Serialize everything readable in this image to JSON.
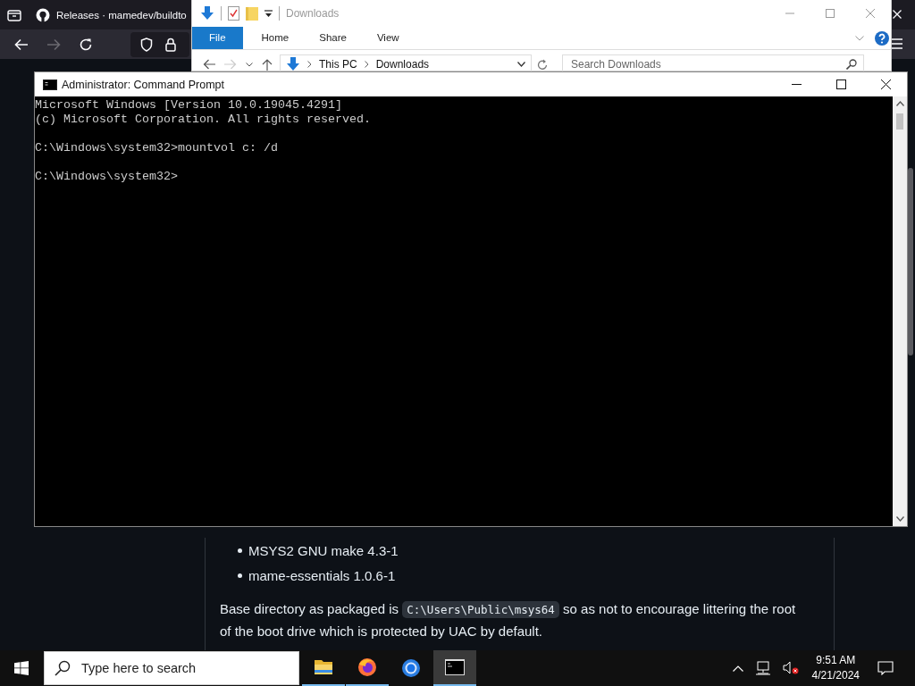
{
  "browser": {
    "tab_title": "Releases · mamedev/buildto",
    "page": {
      "list_items": [
        "MSYS2 GNU make 4.3-1",
        "mame-essentials 1.0.6-1"
      ],
      "paragraph": {
        "before": "Base directory as packaged is ",
        "code": "C:\\Users\\Public\\msys64",
        "after": " so as not to encourage littering the root of the boot drive which is protected by UAC by default."
      }
    }
  },
  "explorer": {
    "title": "Downloads",
    "ribbon_tabs": [
      {
        "label": "File",
        "selected": true
      },
      {
        "label": "Home",
        "selected": false
      },
      {
        "label": "Share",
        "selected": false
      },
      {
        "label": "View",
        "selected": false
      }
    ],
    "breadcrumb": [
      "This PC",
      "Downloads"
    ],
    "search": {
      "placeholder": "Search Downloads"
    }
  },
  "cmd": {
    "title": "Administrator: Command Prompt",
    "blocks": [
      [
        "Microsoft Windows [Version 10.0.19045.4291]",
        "(c) Microsoft Corporation. All rights reserved."
      ],
      [
        "C:\\Windows\\system32>mountvol c: /d"
      ],
      [
        "C:\\Windows\\system32>"
      ]
    ]
  },
  "taskbar": {
    "search": {
      "placeholder": "Type here to search"
    },
    "apps": [
      {
        "kind": "explorer",
        "running": true,
        "selected": false
      },
      {
        "kind": "firefox",
        "running": true,
        "selected": false
      },
      {
        "kind": "chrome",
        "running": false,
        "selected": false
      },
      {
        "kind": "terminal",
        "running": true,
        "selected": true
      }
    ],
    "time": "9:51 AM",
    "date": "4/21/2024"
  }
}
